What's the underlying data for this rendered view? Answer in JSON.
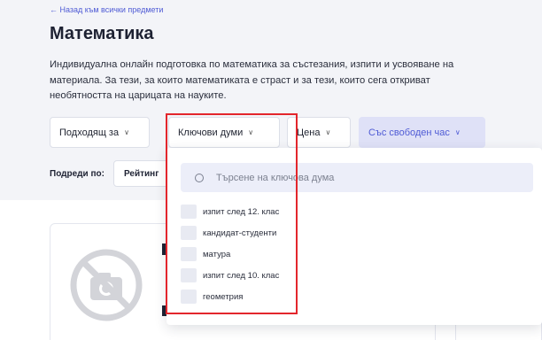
{
  "header": {
    "back_link": "← Назад към всички предмети",
    "title": "Математика",
    "description": "Индивидуална онлайн подготовка по математика за състезания, изпити и усвояване на материала. За тези, за които математиката е страст и за тези, които сега откриват необятността на царицата на науките."
  },
  "filters": [
    {
      "label": "Подходящ за",
      "icon": "chevron-down-icon"
    },
    {
      "label": "Ключови думи",
      "icon": "chevron-down-icon"
    },
    {
      "label": "Цена",
      "icon": "chevron-down-icon"
    },
    {
      "label": "Със свободен час",
      "icon": "chevron-down-icon"
    }
  ],
  "sort": {
    "label": "Подреди по:",
    "selected": "Рейтинг"
  },
  "keyword_dropdown": {
    "search_placeholder": "Търсене на ключова дума",
    "search_icon": "search-icon",
    "items": [
      {
        "label": "изпит след 12. клас",
        "checked": false
      },
      {
        "label": "кандидат-студенти",
        "checked": false
      },
      {
        "label": "матура",
        "checked": false
      },
      {
        "label": "изпит след 10. клас",
        "checked": false
      },
      {
        "label": "геометрия",
        "checked": false
      }
    ]
  },
  "card": {
    "image_icon": "no-photo-icon"
  },
  "colors": {
    "accent": "#4f5bd5",
    "active_filter_bg": "#dfe1f7",
    "highlight": "#e3262c",
    "band_bg": "#f3f4f8"
  }
}
